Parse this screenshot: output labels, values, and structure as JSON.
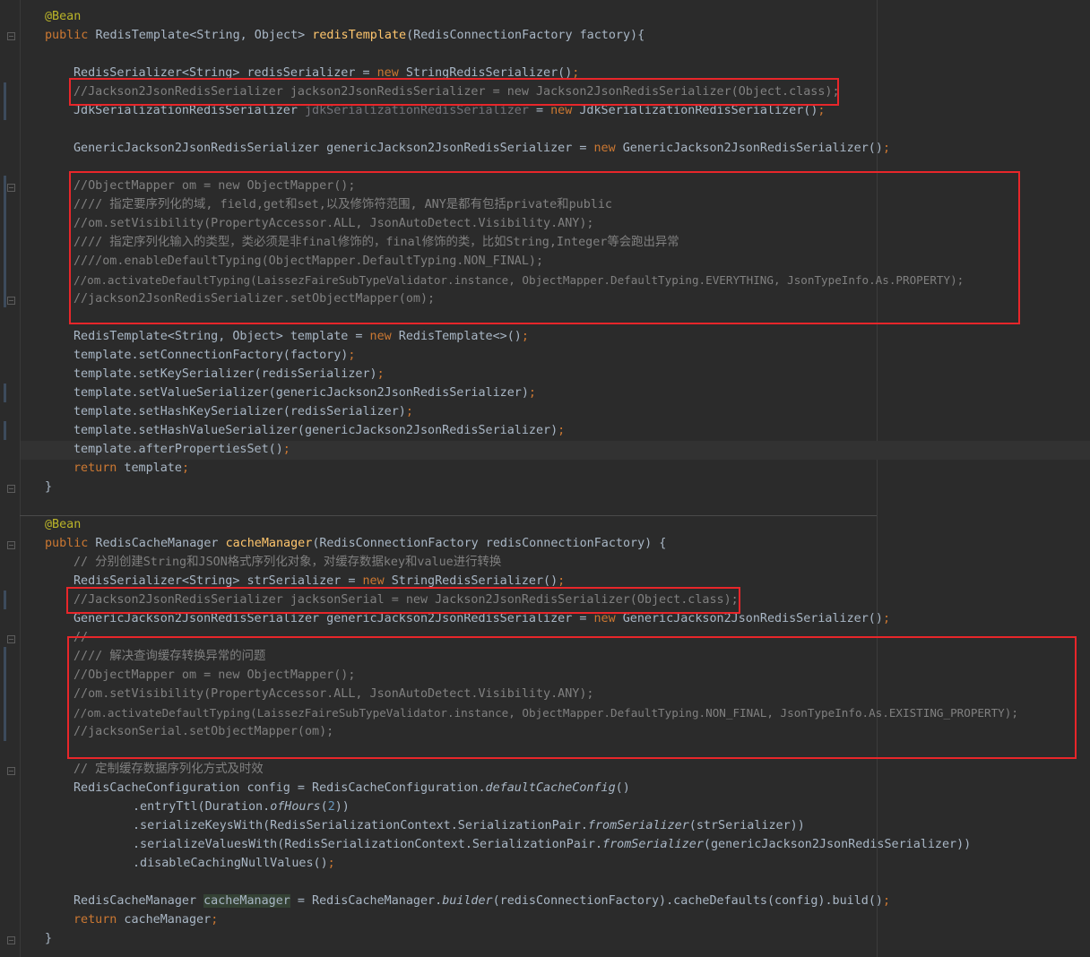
{
  "colors": {
    "background": "#2b2b2b",
    "keyword": "#cc7832",
    "annotation": "#bbb529",
    "method_decl": "#ffc66d",
    "comment": "#808080",
    "number": "#6897bb",
    "text": "#a9b7c6",
    "highlight_box": "#e8262a"
  },
  "icons": {
    "fold_marker": "fold-marker-icon"
  },
  "code": {
    "m1_annotation": "@Bean",
    "m1_sig_kw": "public",
    "m1_sig_type": "RedisTemplate<String, Object>",
    "m1_sig_name": "redisTemplate",
    "m1_sig_params": "(RedisConnectionFactory factory){",
    "l_str_ser_a": "RedisSerializer<String> redisSerializer = ",
    "l_str_ser_new": "new",
    "l_str_ser_b": " StringRedisSerializer()",
    "semi": ";",
    "l_jackson_c": "//Jackson2JsonRedisSerializer jackson2JsonRedisSerializer = new Jackson2JsonRedisSerializer(Object.class);",
    "l_jdk_a": "JdkSerializationRedisSerializer ",
    "l_jdk_var": "jdkSerializationRedisSerializer",
    "l_jdk_b": " = ",
    "l_jdk_new": "new",
    "l_jdk_c": " JdkSerializationRedisSerializer()",
    "l_gen_a": "GenericJackson2JsonRedisSerializer genericJackson2JsonRedisSerializer = ",
    "l_gen_new": "new",
    "l_gen_b": " GenericJackson2JsonRedisSerializer()",
    "c1_1": "//ObjectMapper om = new ObjectMapper();",
    "c1_2": "//// 指定要序列化的域, field,get和set,以及修饰符范围, ANY是都有包括private和public",
    "c1_3": "//om.setVisibility(PropertyAccessor.ALL, JsonAutoDetect.Visibility.ANY);",
    "c1_4": "//// 指定序列化输入的类型，类必须是非final修饰的，final修饰的类，比如String,Integer等会跑出异常",
    "c1_5": "////om.enableDefaultTyping(ObjectMapper.DefaultTyping.NON_FINAL);",
    "c1_6": "//om.activateDefaultTyping(LaissezFaireSubTypeValidator.instance, ObjectMapper.DefaultTyping.EVERYTHING, JsonTypeInfo.As.PROPERTY);",
    "c1_7": "//jackson2JsonRedisSerializer.setObjectMapper(om);",
    "l_tpl_a": "RedisTemplate<String, Object> template = ",
    "l_tpl_new": "new",
    "l_tpl_b": " RedisTemplate<>()",
    "l_t1": "template.setConnectionFactory(factory)",
    "l_t2": "template.setKeySerializer(redisSerializer)",
    "l_t3": "template.setValueSerializer(genericJackson2JsonRedisSerializer)",
    "l_t4": "template.setHashKeySerializer(redisSerializer)",
    "l_t5": "template.setHashValueSerializer(genericJackson2JsonRedisSerializer)",
    "l_t6": "template.afterPropertiesSet()",
    "l_ret_kw": "return",
    "l_ret_var": " template",
    "close_brace": "}",
    "m2_annotation": "@Bean",
    "m2_sig_kw": "public",
    "m2_sig_type": " RedisCacheManager ",
    "m2_sig_name": "cacheManager",
    "m2_sig_params": "(RedisConnectionFactory redisConnectionFactory) {",
    "m2_c_zh": "// 分别创建String和JSON格式序列化对象，对缓存数据key和value进行转换",
    "m2_str_a": "RedisSerializer<String> strSerializer = ",
    "m2_str_new": "new",
    "m2_str_b": " StringRedisSerializer()",
    "m2_jackson_c": "//Jackson2JsonRedisSerializer jacksonSerial = new Jackson2JsonRedisSerializer(Object.class);",
    "m2_gen_a": "GenericJackson2JsonRedisSerializer genericJackson2JsonRedisSerializer = ",
    "m2_gen_new": "new",
    "m2_gen_b": " GenericJackson2JsonRedisSerializer()",
    "c2_0": "//",
    "c2_1": "//// 解决查询缓存转换异常的问题",
    "c2_2": "//ObjectMapper om = new ObjectMapper();",
    "c2_3": "//om.setVisibility(PropertyAccessor.ALL, JsonAutoDetect.Visibility.ANY);",
    "c2_4": "//om.activateDefaultTyping(LaissezFaireSubTypeValidator.instance, ObjectMapper.DefaultTyping.NON_FINAL, JsonTypeInfo.As.EXISTING_PROPERTY);",
    "c2_5": "//jacksonSerial.setObjectMapper(om);",
    "m2_c_cfg": "// 定制缓存数据序列化方式及时效",
    "cfg_a": "RedisCacheConfiguration config = RedisCacheConfiguration.",
    "cfg_b": "defaultCacheConfig",
    "cfg_c": "()",
    "ttl_a": ".entryTtl(Duration.",
    "ttl_b": "ofHours",
    "ttl_c": "(",
    "ttl_num": "2",
    "ttl_d": "))",
    "skw_a": ".serializeKeysWith(RedisSerializationContext.SerializationPair.",
    "skw_b": "fromSerializer",
    "skw_c": "(strSerializer))",
    "svw_a": ".serializeValuesWith(RedisSerializationContext.SerializationPair.",
    "svw_b": "fromSerializer",
    "svw_c": "(genericJackson2JsonRedisSerializer))",
    "dis": ".disableCachingNullValues()",
    "cm_a": "RedisCacheManager ",
    "cm_var": "cacheManager",
    "cm_b": " = RedisCacheManager.",
    "cm_c": "builder",
    "cm_d": "(redisConnectionFactory).cacheDefaults(config).build()",
    "cm_ret_kw": "return",
    "cm_ret_var": " cacheManager",
    "last_brace": "}"
  }
}
